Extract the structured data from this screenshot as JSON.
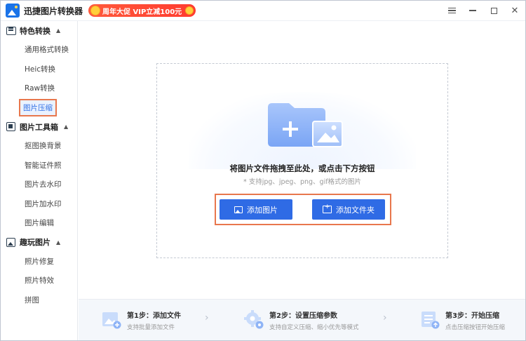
{
  "app": {
    "title": "迅捷图片转换器",
    "promo": "周年大促 VIP立减100元"
  },
  "sidebar": {
    "groups": [
      {
        "label": "特色转换",
        "items": [
          "通用格式转换",
          "Heic转换",
          "Raw转换",
          "图片压缩"
        ]
      },
      {
        "label": "图片工具箱",
        "items": [
          "抠图换背景",
          "智能证件照",
          "图片去水印",
          "图片加水印",
          "图片编辑"
        ]
      },
      {
        "label": "趣玩图片",
        "items": [
          "照片修复",
          "照片特效",
          "拼图"
        ]
      }
    ],
    "active_item": "图片压缩"
  },
  "dropzone": {
    "title": "将图片文件拖拽至此处，或点击下方按钮",
    "subtitle": "* 支持jpg、jpeg、png、gif格式的图片",
    "add_image_label": "添加图片",
    "add_folder_label": "添加文件夹"
  },
  "steps": [
    {
      "title": "第1步：添加文件",
      "desc": "支持批量添加文件"
    },
    {
      "title": "第2步：设置压缩参数",
      "desc": "支持自定义压缩、缩小优先等模式"
    },
    {
      "title": "第3步：开始压缩",
      "desc": "点击压缩按钮开始压缩"
    }
  ],
  "colors": {
    "accent": "#2f6be5",
    "highlight_border": "#e8774d",
    "promo": "#ff3b2f"
  }
}
